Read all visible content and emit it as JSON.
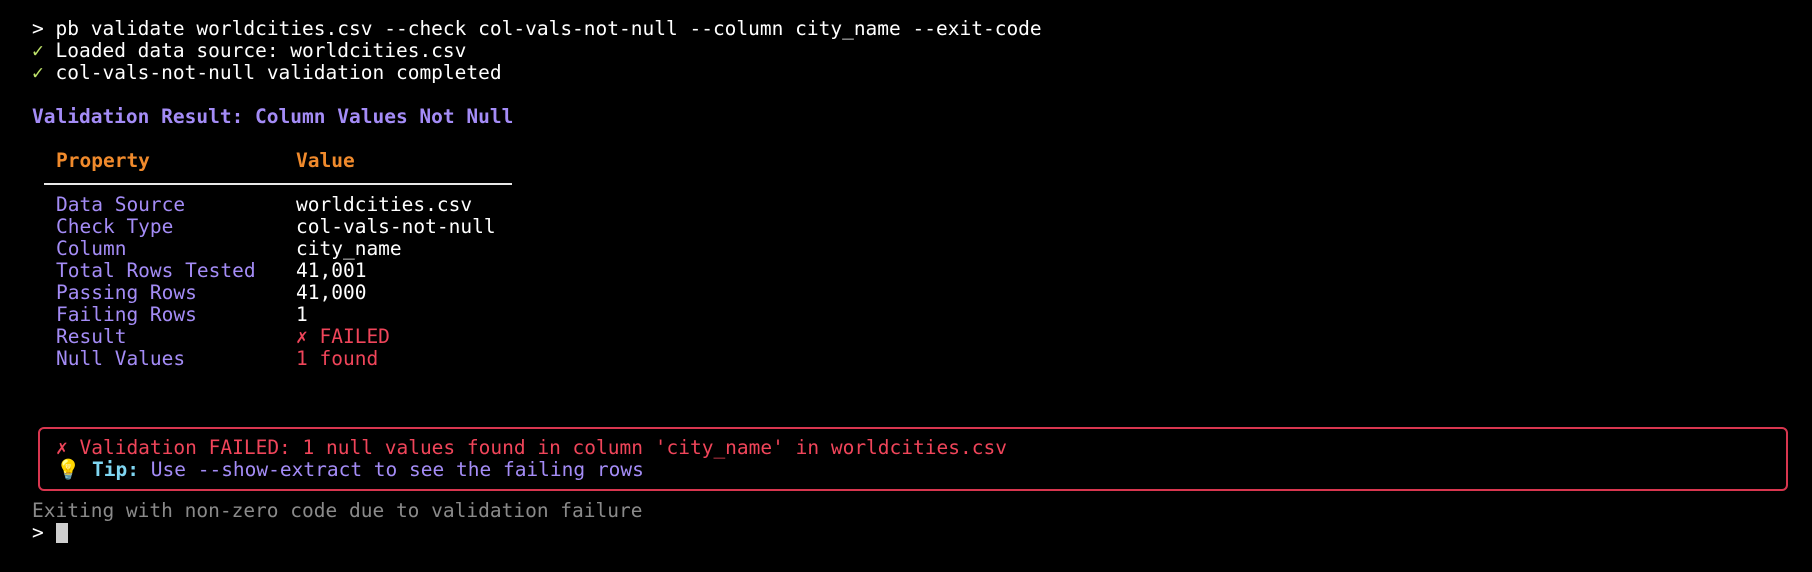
{
  "command": {
    "prompt": ">",
    "text": "pb validate worldcities.csv --check col-vals-not-null --column city_name --exit-code"
  },
  "status": [
    {
      "mark": "✓",
      "text": "Loaded data source: worldcities.csv"
    },
    {
      "mark": "✓",
      "text": "col-vals-not-null validation completed"
    }
  ],
  "result_title": "Validation Result: Column Values Not Null",
  "table": {
    "headers": [
      "Property",
      "Value"
    ],
    "rows": [
      {
        "property": "Data Source",
        "value": "worldcities.csv"
      },
      {
        "property": "Check Type",
        "value": "col-vals-not-null"
      },
      {
        "property": "Column",
        "value": "city_name"
      },
      {
        "property": "Total Rows Tested",
        "value": "41,001"
      },
      {
        "property": "Passing Rows",
        "value": "41,000"
      },
      {
        "property": "Failing Rows",
        "value": "1"
      },
      {
        "property": "Result",
        "value": "✗ FAILED"
      },
      {
        "property": "Null Values",
        "value": "1 found"
      }
    ]
  },
  "error_box": {
    "message": "✗ Validation FAILED: 1 null values found in column 'city_name' in worldcities.csv",
    "tip_icon": "lightbulb-icon",
    "tip_label": "Tip:",
    "tip_text": "Use --show-extract to see the failing rows"
  },
  "exit_message": "Exiting with non-zero code due to validation failure",
  "final_prompt": ">",
  "colors": {
    "background": "#000000",
    "check": "#bfe36a",
    "purple": "#a48cf6",
    "orange": "#f08a2c",
    "red": "#f0455a",
    "cyan": "#7fd6f2",
    "gray": "#8a8a8a"
  }
}
